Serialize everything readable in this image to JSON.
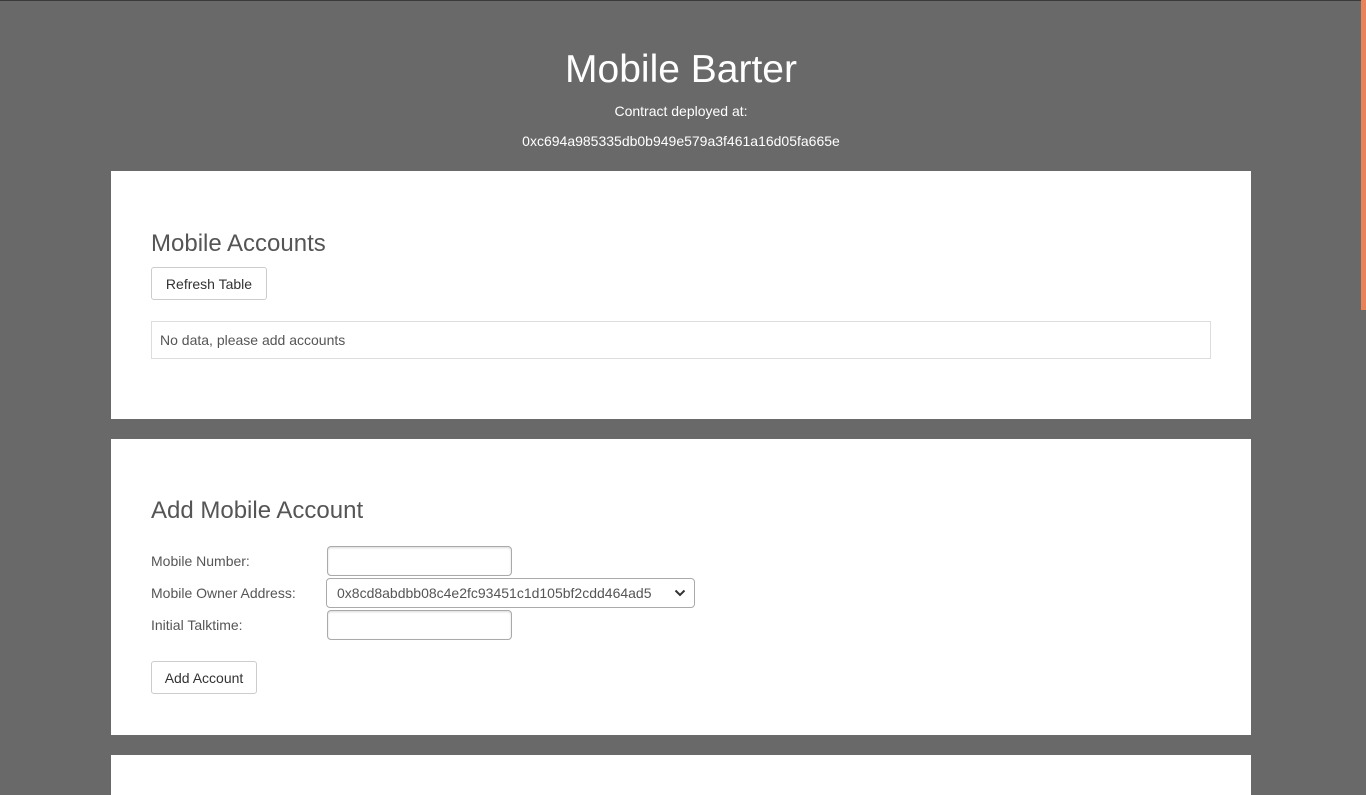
{
  "header": {
    "title": "Mobile Barter",
    "deployed_label": "Contract deployed at:",
    "contract_address": "0xc694a985335db0b949e579a3f461a16d05fa665e"
  },
  "accounts_section": {
    "title": "Mobile Accounts",
    "refresh_button": "Refresh Table",
    "empty_message": "No data, please add accounts"
  },
  "add_section": {
    "title": "Add Mobile Account",
    "mobile_number_label": "Mobile Number:",
    "mobile_number_value": "",
    "owner_address_label": "Mobile Owner Address:",
    "owner_address_selected": "0x8cd8abdbb08c4e2fc93451c1d105bf2cdd464ad5",
    "initial_talktime_label": "Initial Talktime:",
    "initial_talktime_value": "",
    "add_button": "Add Account"
  },
  "colors": {
    "background": "#696969",
    "card": "#ffffff",
    "scrollbar_accent": "#e8825a"
  },
  "icons": {
    "select_arrow": "chevron-down-icon"
  }
}
